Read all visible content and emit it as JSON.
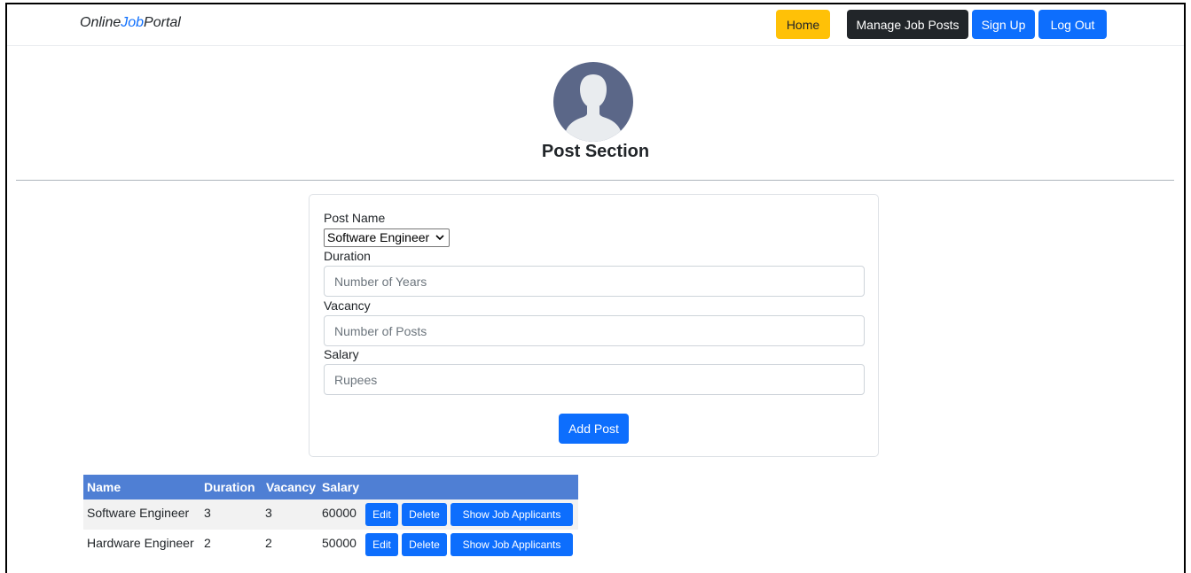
{
  "navbar": {
    "brand_prefix": "Online",
    "brand_accent": "Job",
    "brand_suffix": "Portal",
    "buttons": {
      "home": "Home",
      "manage": "Manage Job Posts",
      "signup": "Sign Up",
      "logout": "Log Out"
    }
  },
  "header": {
    "title": "Post Section",
    "avatar_icon": "user-avatar-icon"
  },
  "form": {
    "post_name_label": "Post Name",
    "post_name_value": "Software Engineer",
    "duration_label": "Duration",
    "duration_placeholder": "Number of Years",
    "vacancy_label": "Vacancy",
    "vacancy_placeholder": "Number of Posts",
    "salary_label": "Salary",
    "salary_placeholder": "Rupees",
    "submit_label": "Add Post"
  },
  "table": {
    "columns": [
      "Name",
      "Duration",
      "Vacancy",
      "Salary"
    ],
    "rows": [
      {
        "name": "Software Engineer",
        "duration": "3",
        "vacancy": "3",
        "salary": "60000",
        "edit": "Edit",
        "delete": "Delete",
        "show": "Show Job Applicants"
      },
      {
        "name": "Hardware Engineer",
        "duration": "2",
        "vacancy": "2",
        "salary": "50000",
        "edit": "Edit",
        "delete": "Delete",
        "show": "Show Job Applicants"
      }
    ]
  },
  "colors": {
    "primary": "#0d6efd",
    "warning": "#ffc107",
    "dark": "#212529",
    "table_header": "#4f7fd4",
    "avatar_bg": "#5b6788"
  }
}
